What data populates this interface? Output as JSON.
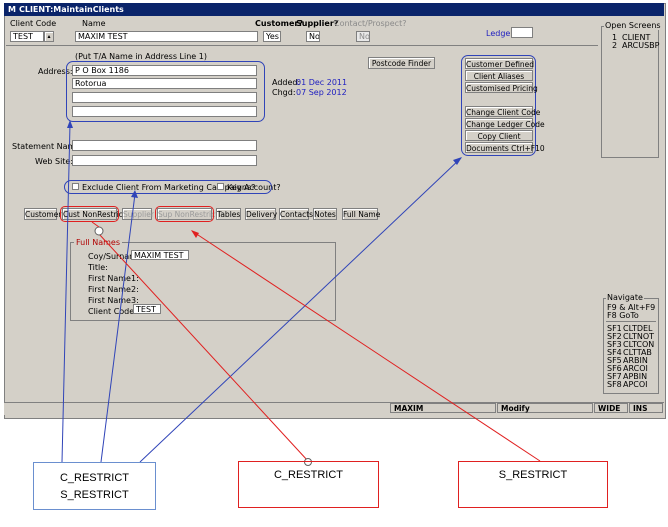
{
  "window": {
    "title": "CLIENT:MaintainClients",
    "icon": "m-logo-icon"
  },
  "header": {
    "client_code_label": "Client Code",
    "client_code_value": "TEST",
    "name_label": "Name",
    "name_value": "MAXIM TEST",
    "customer_label": "Customer?",
    "customer_value": "Yes",
    "supplier_label": "Supplier?",
    "supplier_value": "No",
    "contact_label": "Contact/Prospect?",
    "contact_value": "No",
    "ledger_label": "Ledger:",
    "ledger_value": ""
  },
  "address": {
    "hint": "(Put T/A Name in Address Line 1)",
    "label": "Address:",
    "lines": [
      "P O Box 1186",
      "Rotorua",
      "",
      ""
    ],
    "postcode_button": "Postcode Finder",
    "added_label": "Added:",
    "added_value": "01 Dec 2011",
    "changed_label": "Chgd:",
    "changed_value": "07 Sep 2012"
  },
  "statement_name_label": "Statement Name:",
  "statement_name_value": "",
  "website_label": "Web Site:",
  "website_value": "",
  "exclude_label": "Exclude Client From Marketing Campaigns?",
  "key_account_label": "Key Account?",
  "side_buttons": [
    "Customer Defined",
    "Client Aliases",
    "Customised Pricing",
    "Change Client Code",
    "Change Ledger Code",
    "Copy Client",
    "Documents Ctrl+F10"
  ],
  "tabs": [
    "Customer",
    "Cust NonRestrict",
    "Supplier",
    "Sup NonRestrict",
    "Tables",
    "Delivery",
    "Contacts",
    "Notes",
    "Full Name"
  ],
  "full_names": {
    "legend": "Full Names",
    "coy_label": "Coy/Surname:",
    "coy_value": "MAXIM TEST",
    "title_label": "Title:",
    "first1_label": "First Name1:",
    "first2_label": "First Name2:",
    "first3_label": "First Name3:",
    "client_code_label": "Client Code:",
    "client_code_value": "TEST"
  },
  "open_screens": {
    "title": "Open Screens",
    "items": [
      {
        "num": "1",
        "name": "CLIENT"
      },
      {
        "num": "2",
        "name": "ARCUSBP"
      }
    ]
  },
  "navigate": {
    "title": "Navigate",
    "line1": "F9 & Alt+F9",
    "line2": "F8   GoTo",
    "keys": [
      {
        "key": "SF1",
        "code": "CLTDEL"
      },
      {
        "key": "SF2",
        "code": "CLTNOT"
      },
      {
        "key": "SF3",
        "code": "CLTCON"
      },
      {
        "key": "SF4",
        "code": "CLTTAB"
      },
      {
        "key": "SF5",
        "code": "ARBIN"
      },
      {
        "key": "SF6",
        "code": "ARCOI"
      },
      {
        "key": "SF7",
        "code": "APBIN"
      },
      {
        "key": "SF8",
        "code": "APCOI"
      }
    ]
  },
  "status_bar": {
    "user": "MAXIM",
    "mode": "Modify",
    "width": "WIDE",
    "ins": "INS"
  },
  "annotations": {
    "left_line1": "C_RESTRICT",
    "left_line2": "S_RESTRICT",
    "middle": "C_RESTRICT",
    "right": "S_RESTRICT"
  },
  "colors": {
    "title_bar": "#0a246a",
    "window_bg": "#d4d0c8",
    "annotation_blue": "#3044b8",
    "annotation_red": "#e02020",
    "date_blue": "#2020c0"
  }
}
